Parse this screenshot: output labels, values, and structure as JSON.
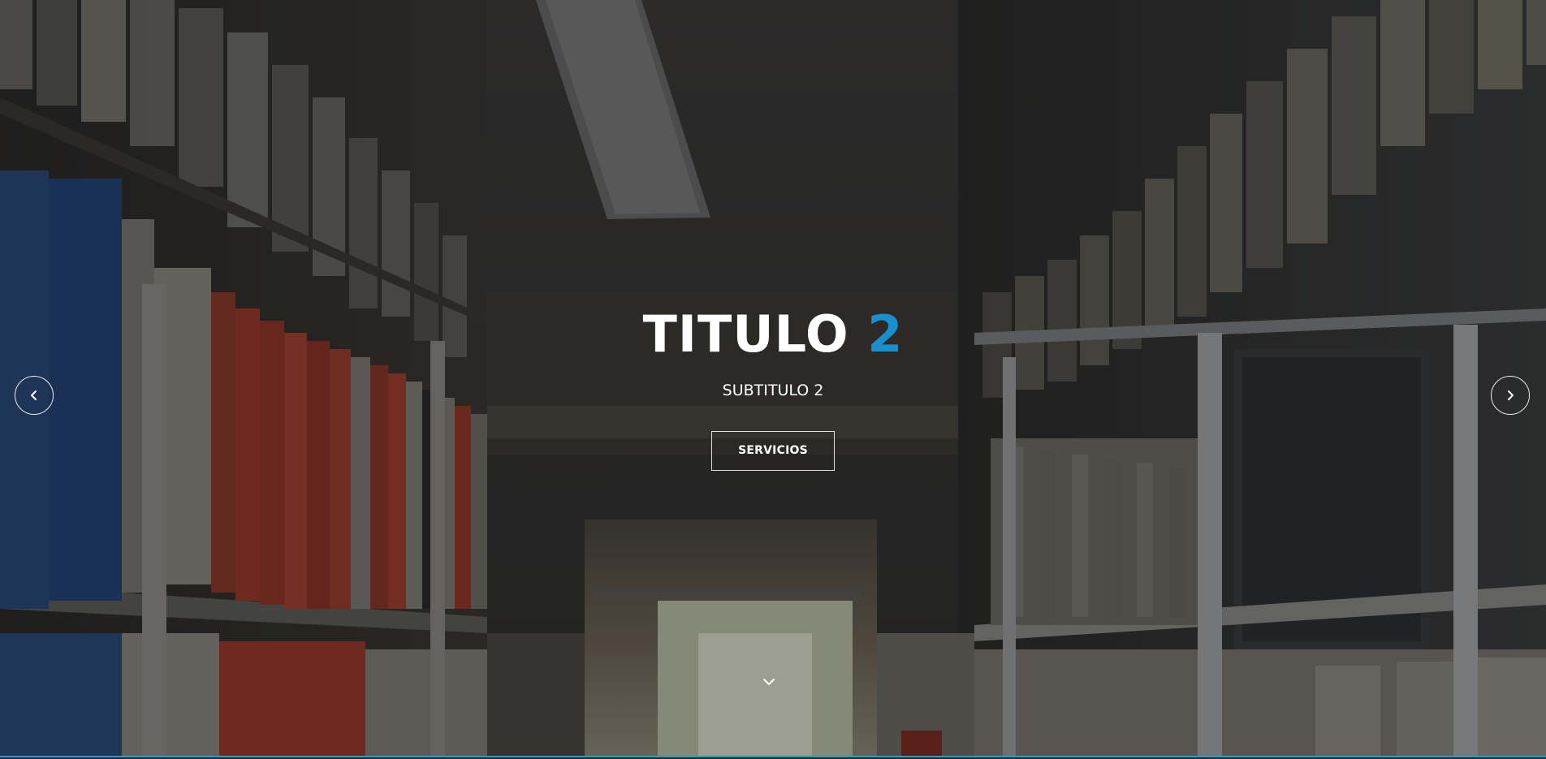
{
  "hero": {
    "title_main": "TITULO",
    "title_accent": "2",
    "subtitle": "SUBTITULO 2",
    "cta_label": "SERVICIOS"
  },
  "navigation": {
    "prev_icon": "chevron-left-icon",
    "next_icon": "chevron-right-icon",
    "scroll_icon": "chevron-down-icon"
  },
  "colors": {
    "accent": "#1a8fcf",
    "bottom_border": "#1e9fdc",
    "text": "#ffffff"
  }
}
